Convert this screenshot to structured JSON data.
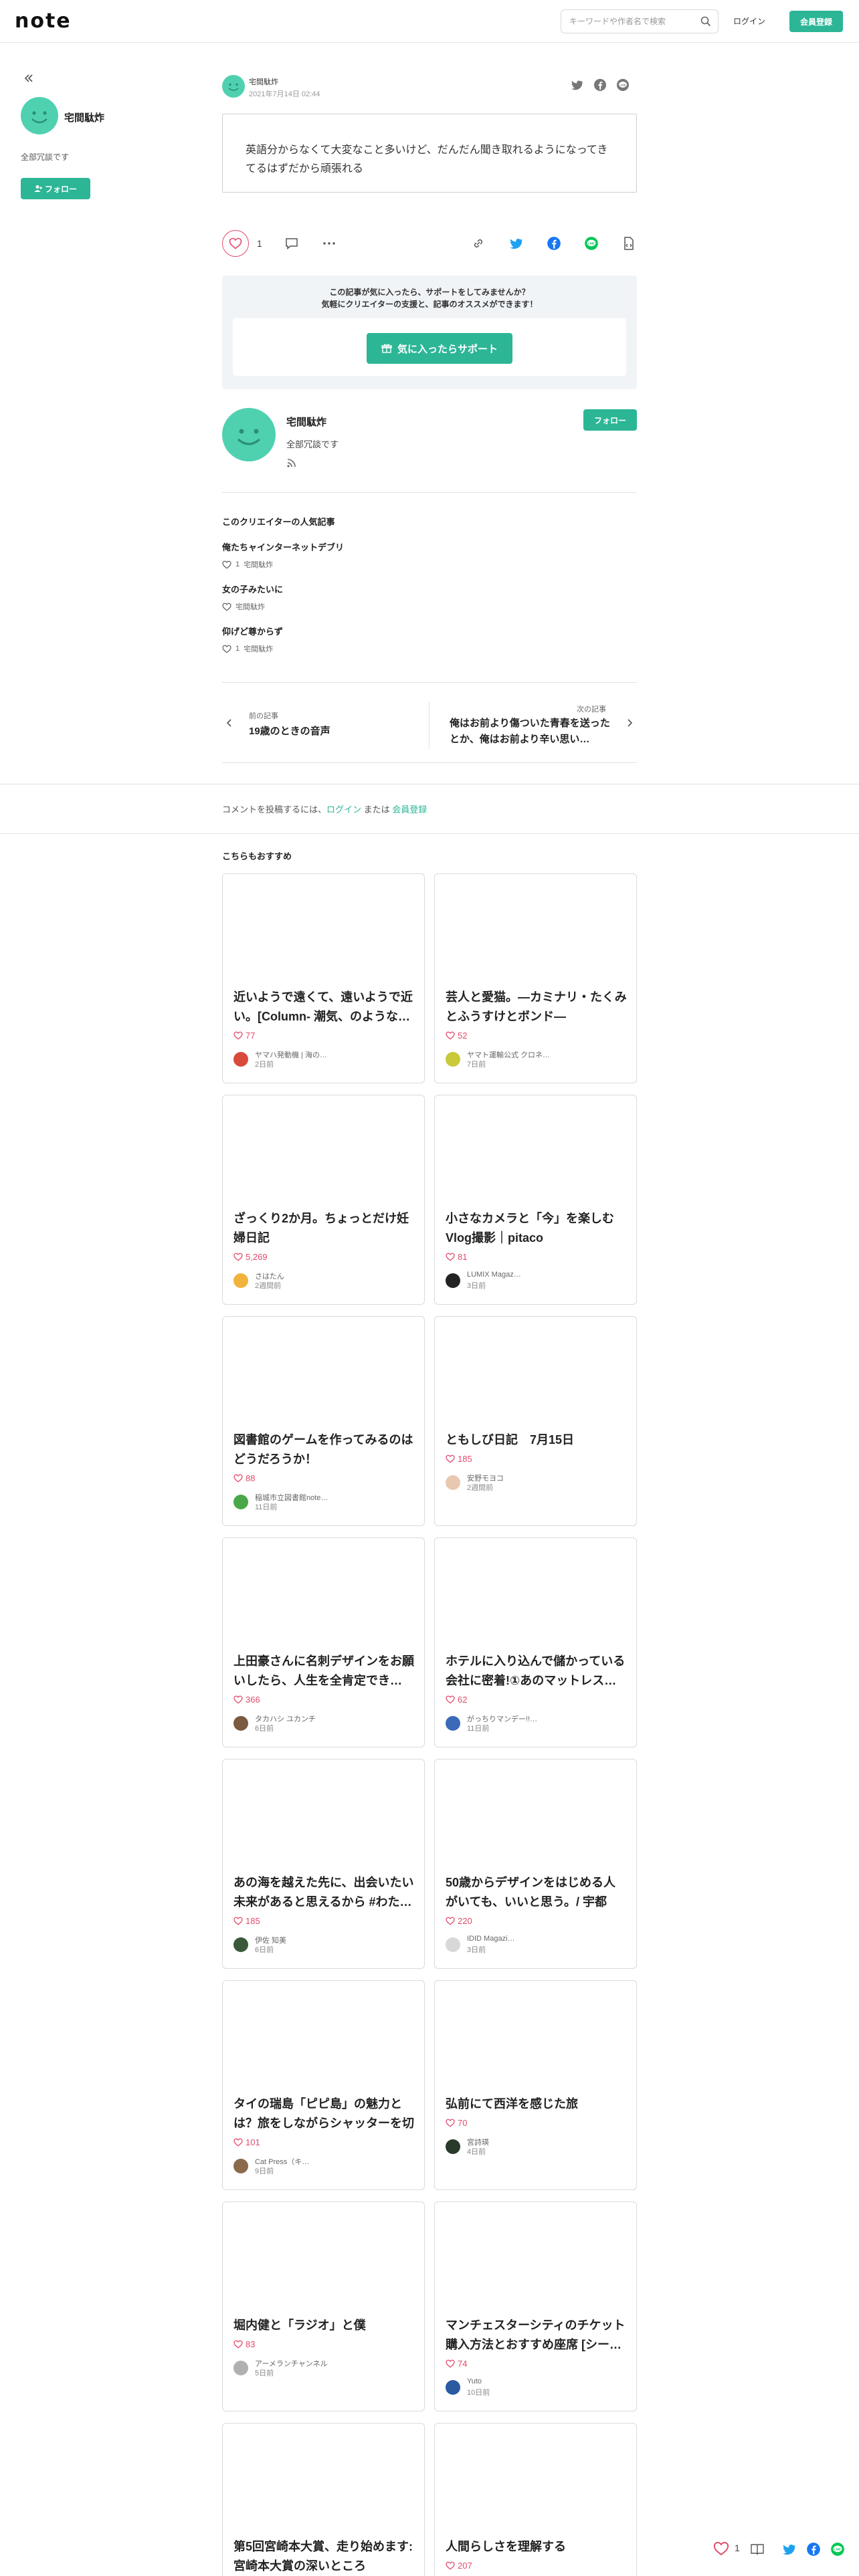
{
  "header": {
    "logo": "note",
    "search_placeholder": "キーワードや作者名で検索",
    "login": "ログイン",
    "signup": "会員登録"
  },
  "sidebar": {
    "name": "宅間駄炸",
    "bio": "全部冗談です",
    "follow": "フォロー"
  },
  "article": {
    "author": "宅間駄炸",
    "date": "2021年7月14日 02:44",
    "body": "英語分からなくて大変なこと多いけど、だんだん聞き取れるようになってきてるはずだから頑張れる",
    "like_count": "1"
  },
  "support": {
    "line1": "この記事が気に入ったら、サポートをしてみませんか？",
    "line2": "気軽にクリエイターの支援と、記事のオススメができます！",
    "button": "気に入ったらサポート"
  },
  "creator": {
    "name": "宅間駄炸",
    "bio": "全部冗談です",
    "follow": "フォロー"
  },
  "popular": {
    "title": "このクリエイターの人気記事",
    "items": [
      {
        "title": "俺たちャインターネットデブリ",
        "likes": "1",
        "author": "宅間駄炸"
      },
      {
        "title": "女の子みたいに",
        "likes": "",
        "author": "宅間駄炸"
      },
      {
        "title": "仰げど尊からず",
        "likes": "1",
        "author": "宅間駄炸"
      }
    ]
  },
  "nav": {
    "prev_label": "前の記事",
    "prev_title": "19歳のときの音声",
    "next_label": "次の記事",
    "next_title": "俺はお前より傷ついた青春を送ったとか、俺はお前より辛い思い…"
  },
  "comment": {
    "prefix": "コメントを投稿するには、",
    "login": "ログイン",
    "or": " または ",
    "signup": "会員登録"
  },
  "recommend": {
    "title": "こちらもおすすめ",
    "cards": [
      {
        "title": "近いようで遠くて、遠いようで近い。[Column- 潮気、のような…",
        "likes": "77",
        "author": "ヤマハ発動機 | 海の…",
        "date": "2日前",
        "avatar_color": "#d94a3a"
      },
      {
        "title": "芸人と愛猫。―カミナリ・たくみとふうすけとボンド―",
        "likes": "52",
        "author": "ヤマト運輸公式 クロネ…",
        "date": "7日前",
        "avatar_color": "#c9c93a"
      },
      {
        "title": "ざっくり2か月。ちょっとだけ妊婦日記",
        "likes": "5,269",
        "author": "さはたん",
        "date": "2週間前",
        "avatar_color": "#f2b33d"
      },
      {
        "title": "小さなカメラと「今」を楽しむVlog撮影｜pitaco",
        "likes": "81",
        "author": "LUMIX Magaz…",
        "date": "3日前",
        "avatar_color": "#222222"
      },
      {
        "title": "図書館のゲームを作ってみるのはどうだろうか！",
        "likes": "88",
        "author": "稲城市立図書館note…",
        "date": "11日前",
        "avatar_color": "#4aa84a"
      },
      {
        "title": "ともしび日記　7月15日",
        "likes": "185",
        "author": "安野モヨコ",
        "date": "2週間前",
        "avatar_color": "#e8c8b0"
      },
      {
        "title": "上田豪さんに名刺デザインをお願いしたら、人生を全肯定でき…",
        "likes": "366",
        "author": "タカハシ ユカンチ",
        "date": "6日前",
        "avatar_color": "#7a5a40"
      },
      {
        "title": "ホテルに入り込んで儲かっている会社に密着!①あのマットレス…",
        "likes": "62",
        "author": "がっちりマンデー!!…",
        "date": "11日前",
        "avatar_color": "#3a6ab8"
      },
      {
        "title": "あの海を越えた先に、出会いたい未来があると思えるから #わた…",
        "likes": "185",
        "author": "伊佐 知美",
        "date": "6日前",
        "avatar_color": "#3a5a3a"
      },
      {
        "title": "50歳からデザインをはじめる人がいても、いいと思う。/ 宇都宮…",
        "likes": "220",
        "author": "IDID Magazi…",
        "date": "3日前",
        "avatar_color": "#d8d8d8"
      },
      {
        "title": "タイの瑞島「ピピ島」の魅力とは？旅をしながらシャッターを切り…",
        "likes": "101",
        "author": "Cat Press（キ…",
        "date": "9日前",
        "avatar_color": "#8a6a4a"
      },
      {
        "title": "弘前にて西洋を感じた旅",
        "likes": "70",
        "author": "宮詩瑛",
        "date": "4日前",
        "avatar_color": "#2a3a2a"
      },
      {
        "title": "堀内健と「ラジオ」と僕",
        "likes": "83",
        "author": "アーメランチャンネル",
        "date": "5日前",
        "avatar_color": "#b0b0b0"
      },
      {
        "title": "マンチェスターシティのチケット購入方法とおすすめ座席 [シー…",
        "likes": "74",
        "author": "Yuto",
        "date": "10日前",
        "avatar_color": "#2a5aa0"
      },
      {
        "title": "第5回宮崎本大賞、走り始めます: 宮崎本大賞の深いところ",
        "likes": "",
        "author": "",
        "date": "",
        "avatar_color": "#cccccc"
      },
      {
        "title": "人間らしさを理解する",
        "likes": "207",
        "author": "",
        "date": "",
        "avatar_color": "#cccccc"
      }
    ]
  },
  "footer": {
    "like_count": "1"
  },
  "colors": {
    "accent": "#2cb696",
    "like": "#e24b6b",
    "twitter": "#1da1f2",
    "facebook": "#1877f2",
    "line": "#06c755"
  }
}
